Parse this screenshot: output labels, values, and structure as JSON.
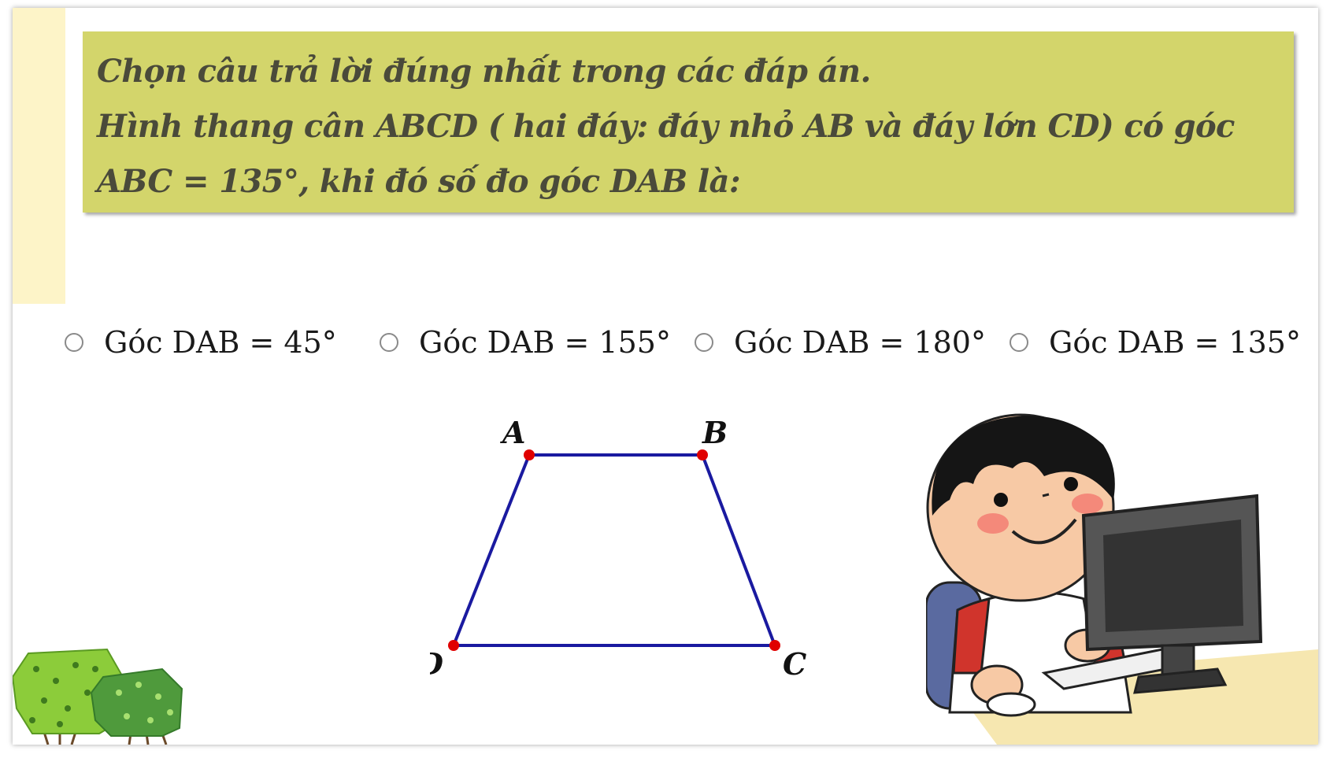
{
  "question": {
    "line1": "Chọn câu trả lời đúng nhất trong các đáp án.",
    "line2": "Hình thang cân ABCD ( hai đáy: đáy nhỏ AB và đáy lớn CD) có góc",
    "line3": "ABC = 135°, khi đó số đo góc DAB là:"
  },
  "options": [
    {
      "label": "Góc DAB = 45°"
    },
    {
      "label": "Góc DAB = 155°"
    },
    {
      "label": "Góc DAB = 180°"
    },
    {
      "label": "Góc DAB = 135°"
    }
  ],
  "figure": {
    "labels": {
      "A": "A",
      "B": "B",
      "C": "C",
      "D": "D"
    },
    "line_color": "#1a1aa0",
    "point_color": "#e00000"
  },
  "colors": {
    "question_bg": "#d3d56b",
    "side_bar": "#fdf4c8",
    "question_text": "#4a4a3a"
  },
  "icons": [
    "radio-icon",
    "boy-computer-illustration",
    "bush-illustration"
  ]
}
